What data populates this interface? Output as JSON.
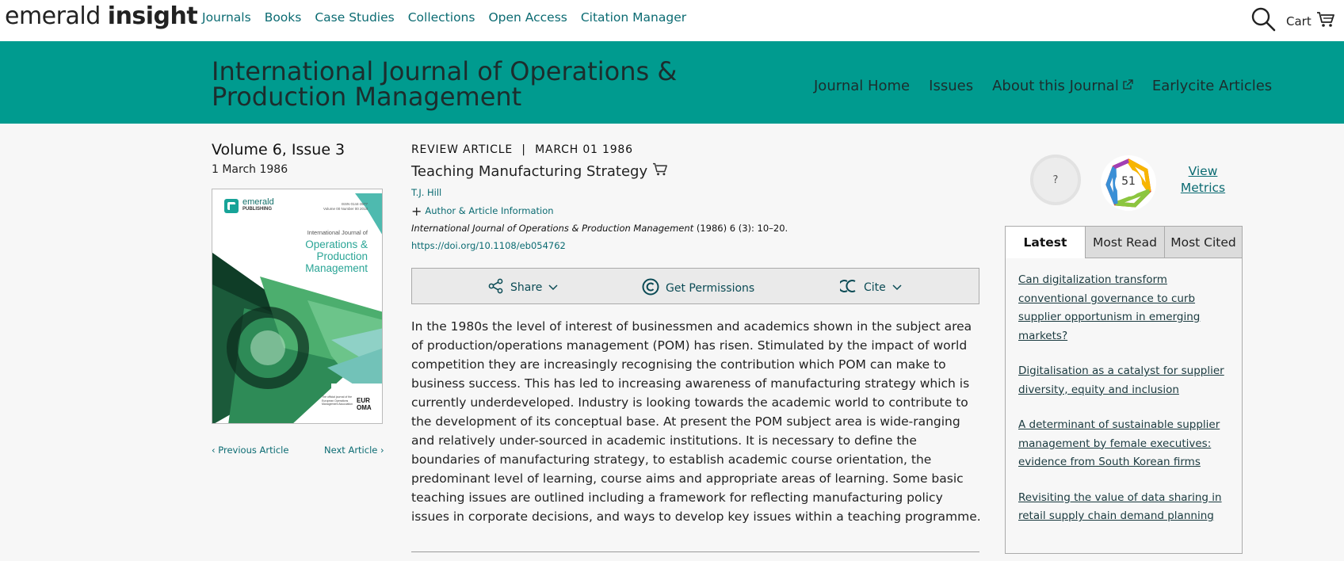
{
  "header": {
    "logo_light": "emerald",
    "logo_bold": "insight",
    "nav": [
      "Journals",
      "Books",
      "Case Studies",
      "Collections",
      "Open Access",
      "Citation Manager"
    ],
    "cart_label": "Cart"
  },
  "journal": {
    "title": "International Journal of Operations & Production Management",
    "nav": [
      "Journal Home",
      "Issues",
      "About this Journal",
      "Earlycite Articles"
    ]
  },
  "issue": {
    "title": "Volume 6, Issue 3",
    "date": "1 March 1986",
    "prev_label": "Previous Article",
    "next_label": "Next Article"
  },
  "cover": {
    "brand_line1": "emerald",
    "brand_line2": "PUBLISHING",
    "issn": "ISSN 0144-3577",
    "volume_line": "Volume 00 Number 00 2018",
    "journal_small": "International Journal of",
    "journal_big1": "Operations &",
    "journal_big2": "Production",
    "journal_big3": "Management",
    "footer_text": "The official journal of the European Operations Management Association",
    "footer_logo": "EUR OMA"
  },
  "article": {
    "type": "REVIEW ARTICLE",
    "separator": "|",
    "date": "MARCH 01 1986",
    "title": "Teaching Manufacturing Strategy",
    "author": "T.J. Hill",
    "author_info_label": "Author & Article Information",
    "citation_journal": "International Journal of Operations & Production Management",
    "citation_rest": " (1986) 6 (3): 10–20.",
    "doi": "https://doi.org/10.1108/eb054762",
    "abstract": "In the 1980s the level of interest of businessmen and academics shown in the subject area of production/operations management (POM) has risen. Stimulated by the impact of world competition they are increasingly recognising the contribution which POM can make to business success. This has led to increasing awareness of manufacturing strategy which is currently underdeveloped. Industry is looking towards the academic world to contribute to the development of its conceptual base. At present the POM subject area is wide-ranging and relatively under-sourced in academic institutions. It is necessary to define the boundaries of manufacturing strategy, to establish academic course orientation, the predominant level of learning, course aims and appropriate areas of learning. Some basic teaching issues are outlined including a framework for reflecting manufacturing policy issues in corporate decisions, and ways to develop key issues within a teaching programme."
  },
  "toolbar": {
    "share": "Share",
    "permissions": "Get Permissions",
    "cite": "Cite"
  },
  "metrics": {
    "altmetric_label": "?",
    "dimensions_count": "51",
    "view_metrics": "View Metrics"
  },
  "sidebar": {
    "tabs": [
      "Latest",
      "Most Read",
      "Most Cited"
    ],
    "active_tab": "Latest",
    "latest": [
      "Can digitalization transform conventional governance to curb supplier opportunism in emerging markets?",
      "Digitalisation as a catalyst for supplier diversity, equity and inclusion",
      "A determinant of sustainable supplier management by female executives: evidence from South Korean firms",
      "Revisiting the value of data sharing in retail supply chain demand planning"
    ]
  },
  "colors": {
    "banner": "#009b8f",
    "link": "#0b6b72",
    "background": "#f7f7f7"
  }
}
